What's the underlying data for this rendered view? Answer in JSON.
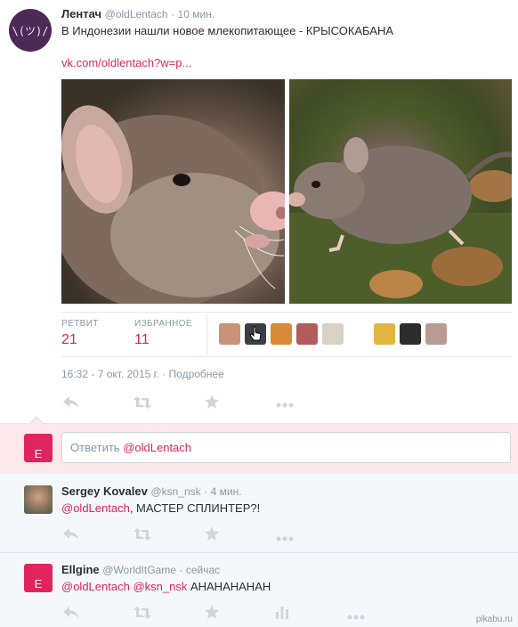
{
  "tweet": {
    "avatar_glyph": "\\(ツ)/",
    "fullname": "Лентач",
    "username": "@oldLentach",
    "time": "· 10 мин.",
    "text": "В Индонезии нашли новое млекопитающее - КРЫСОКАБАНА",
    "link": "vk.com/oldlentach?w=p...",
    "stats": {
      "retweets_label": "РЕТВИТ",
      "retweets_count": "21",
      "favorites_label": "ИЗБРАННОЕ",
      "favorites_count": "11"
    },
    "timestamp": "16:32 - 7 окт. 2015 г.",
    "details_link": "· Подробнее",
    "actions": {
      "reply_icon": "reply-icon",
      "retweet_icon": "retweet-icon",
      "favorite_icon": "star-icon",
      "more_icon": "more-icon"
    }
  },
  "reply_box": {
    "avatar_letter": "E",
    "placeholder_prefix": "Ответить",
    "placeholder_mention": "@oldLentach"
  },
  "replies": [
    {
      "fullname": "Sergey Kovalev",
      "username": "@ksn_nsk",
      "time": "· 4 мин.",
      "mention": "@oldLentach",
      "text": ", МАСТЕР СПЛИНТЕР?!"
    },
    {
      "avatar_letter": "E",
      "fullname": "Ellgine",
      "username": "@WorldItGame",
      "time": "· сейчас",
      "mention1": "@oldLentach",
      "mention2": "@ksn_nsk",
      "text": "АНАНАНАНАН"
    }
  ],
  "watermark": "pikabu.ru",
  "colors": {
    "accent": "#e0245e",
    "muted": "#8899a6",
    "text": "#292f33"
  }
}
